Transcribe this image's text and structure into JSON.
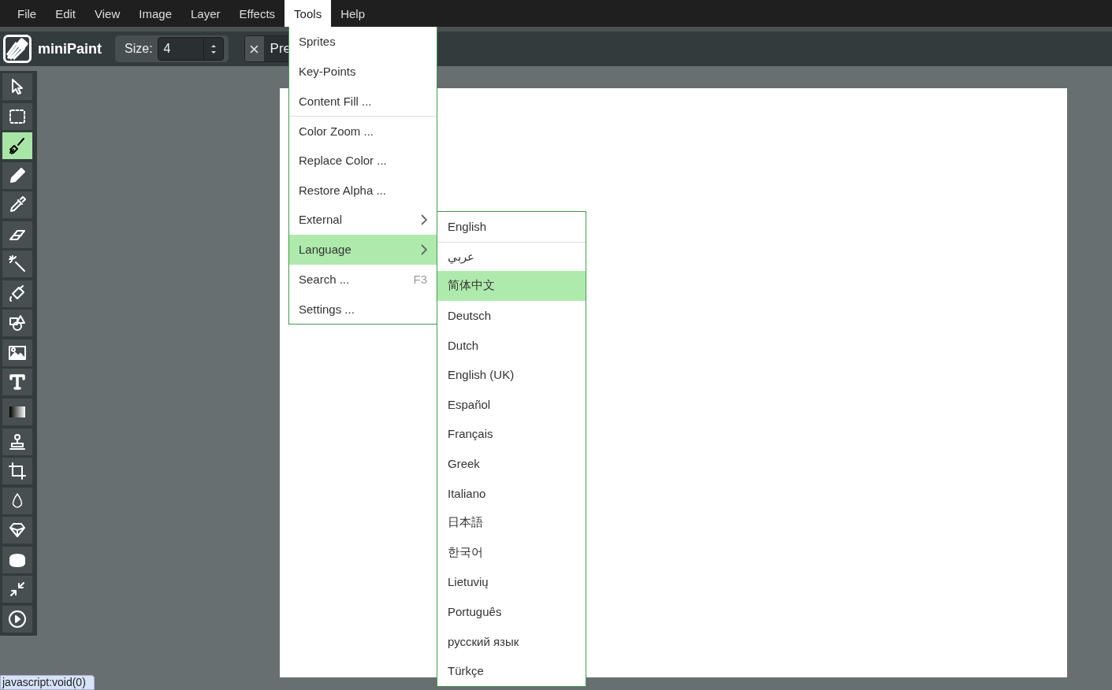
{
  "menubar": [
    {
      "label": "File",
      "selected": false
    },
    {
      "label": "Edit",
      "selected": false
    },
    {
      "label": "View",
      "selected": false
    },
    {
      "label": "Image",
      "selected": false
    },
    {
      "label": "Layer",
      "selected": false
    },
    {
      "label": "Effects",
      "selected": false
    },
    {
      "label": "Tools",
      "selected": true
    },
    {
      "label": "Help",
      "selected": false
    }
  ],
  "toolbar": {
    "app_name": "miniPaint",
    "size_label": "Size:",
    "size_value": "4",
    "preset_label": "Pre"
  },
  "tools": [
    {
      "kind": "select",
      "selected": false
    },
    {
      "kind": "selection",
      "selected": false
    },
    {
      "kind": "brush",
      "selected": true
    },
    {
      "kind": "pencil",
      "selected": false
    },
    {
      "kind": "pick_color",
      "selected": false
    },
    {
      "kind": "erase",
      "selected": false
    },
    {
      "kind": "magic_wand",
      "selected": false
    },
    {
      "kind": "fill",
      "selected": false
    },
    {
      "kind": "shape",
      "selected": false
    },
    {
      "kind": "media",
      "selected": false
    },
    {
      "kind": "text",
      "selected": false
    },
    {
      "kind": "gradient",
      "selected": false
    },
    {
      "kind": "clone",
      "selected": false
    },
    {
      "kind": "crop",
      "selected": false
    },
    {
      "kind": "blur",
      "selected": false
    },
    {
      "kind": "sharpen",
      "selected": false
    },
    {
      "kind": "desaturate",
      "selected": false
    },
    {
      "kind": "bulge",
      "selected": false
    },
    {
      "kind": "animation",
      "selected": false
    }
  ],
  "tools_menu": [
    {
      "label": "Sprites",
      "selected": false,
      "separator": false
    },
    {
      "label": "Key-Points",
      "selected": false,
      "separator": false
    },
    {
      "label": "Content Fill ...",
      "selected": false,
      "separator": false
    },
    {
      "label": "Color Zoom ...",
      "selected": false,
      "separator": true
    },
    {
      "label": "Replace Color ...",
      "selected": false,
      "separator": false
    },
    {
      "label": "Restore Alpha ...",
      "selected": false,
      "separator": false
    },
    {
      "label": "External",
      "selected": false,
      "separator": false,
      "submenu": true
    },
    {
      "label": "Language",
      "selected": true,
      "separator": false,
      "submenu": true
    },
    {
      "label": "Search ...",
      "selected": false,
      "separator": false,
      "shortcut": "F3"
    },
    {
      "label": "Settings ...",
      "selected": false,
      "separator": false
    }
  ],
  "language_menu": [
    {
      "label": "English",
      "selected": false,
      "separator": false
    },
    {
      "label": "عربي",
      "selected": false,
      "separator": true
    },
    {
      "label": "简体中文",
      "selected": true,
      "separator": false
    },
    {
      "label": "Deutsch",
      "selected": false,
      "separator": false
    },
    {
      "label": "Dutch",
      "selected": false,
      "separator": false
    },
    {
      "label": "English (UK)",
      "selected": false,
      "separator": false
    },
    {
      "label": "Español",
      "selected": false,
      "separator": false
    },
    {
      "label": "Français",
      "selected": false,
      "separator": false
    },
    {
      "label": "Greek",
      "selected": false,
      "separator": false
    },
    {
      "label": "Italiano",
      "selected": false,
      "separator": false
    },
    {
      "label": "日本語",
      "selected": false,
      "separator": false
    },
    {
      "label": "한국어",
      "selected": false,
      "separator": false
    },
    {
      "label": "Lietuvių",
      "selected": false,
      "separator": false
    },
    {
      "label": "Português",
      "selected": false,
      "separator": false
    },
    {
      "label": "русский язык",
      "selected": false,
      "separator": false
    },
    {
      "label": "Türkçe",
      "selected": false,
      "separator": false
    }
  ],
  "status_link": "javascript:void(0)"
}
